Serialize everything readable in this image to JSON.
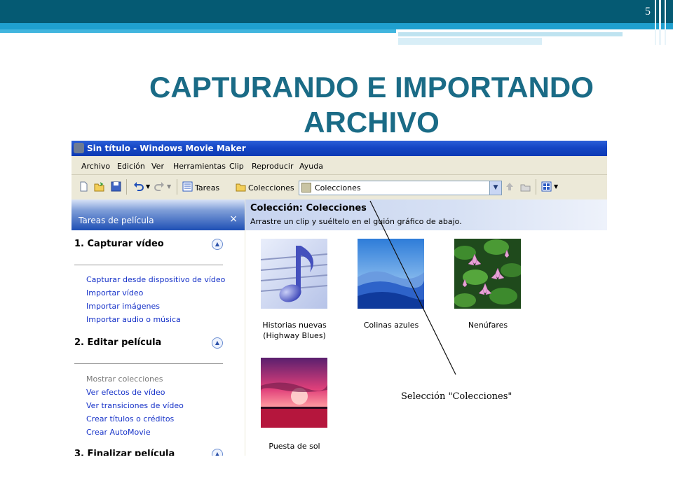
{
  "slide": {
    "number": "5",
    "title": "CAPTURANDO E IMPORTANDO ARCHIVO"
  },
  "window": {
    "title": "Sin título - Windows Movie Maker"
  },
  "menu": [
    "Archivo",
    "Edición",
    "Ver",
    "Herramientas",
    "Clip",
    "Reproducir",
    "Ayuda"
  ],
  "toolbar": {
    "tasks_label": "Tareas",
    "collections_label": "Colecciones",
    "address_value": "Colecciones"
  },
  "task_pane": {
    "title": "Tareas de película",
    "close": "×",
    "sections": [
      {
        "title": "1. Capturar vídeo",
        "links": [
          {
            "label": "Capturar desde dispositivo de vídeo",
            "enabled": true
          },
          {
            "label": "Importar vídeo",
            "enabled": true
          },
          {
            "label": "Importar imágenes",
            "enabled": true
          },
          {
            "label": "Importar audio o música",
            "enabled": true
          }
        ]
      },
      {
        "title": "2. Editar película",
        "links": [
          {
            "label": "Mostrar colecciones",
            "enabled": false
          },
          {
            "label": "Ver efectos de vídeo",
            "enabled": true
          },
          {
            "label": "Ver transiciones de vídeo",
            "enabled": true
          },
          {
            "label": "Crear títulos o créditos",
            "enabled": true
          },
          {
            "label": "Crear AutoMovie",
            "enabled": true
          }
        ]
      },
      {
        "title": "3. Finalizar película",
        "links": []
      }
    ]
  },
  "collection": {
    "title": "Colección: Colecciones",
    "subtitle": "Arrastre un clip y suéltelo en el guión gráfico de abajo.",
    "items": [
      {
        "label": "Historias nuevas (Highway Blues)",
        "kind": "music-note-icon"
      },
      {
        "label": "Colinas azules",
        "kind": "blue-hills-image"
      },
      {
        "label": "Nenúfares",
        "kind": "water-lilies-image"
      },
      {
        "label": "Puesta de sol",
        "kind": "sunset-image"
      }
    ]
  },
  "annotation": "Selección \"Colecciones\"",
  "colors": {
    "slide_band": "#055a73",
    "slide_accent": "#1fa0cf",
    "title": "#1a6b86",
    "xp_title_bar": "#0d3bb5",
    "link": "#1632c8"
  }
}
